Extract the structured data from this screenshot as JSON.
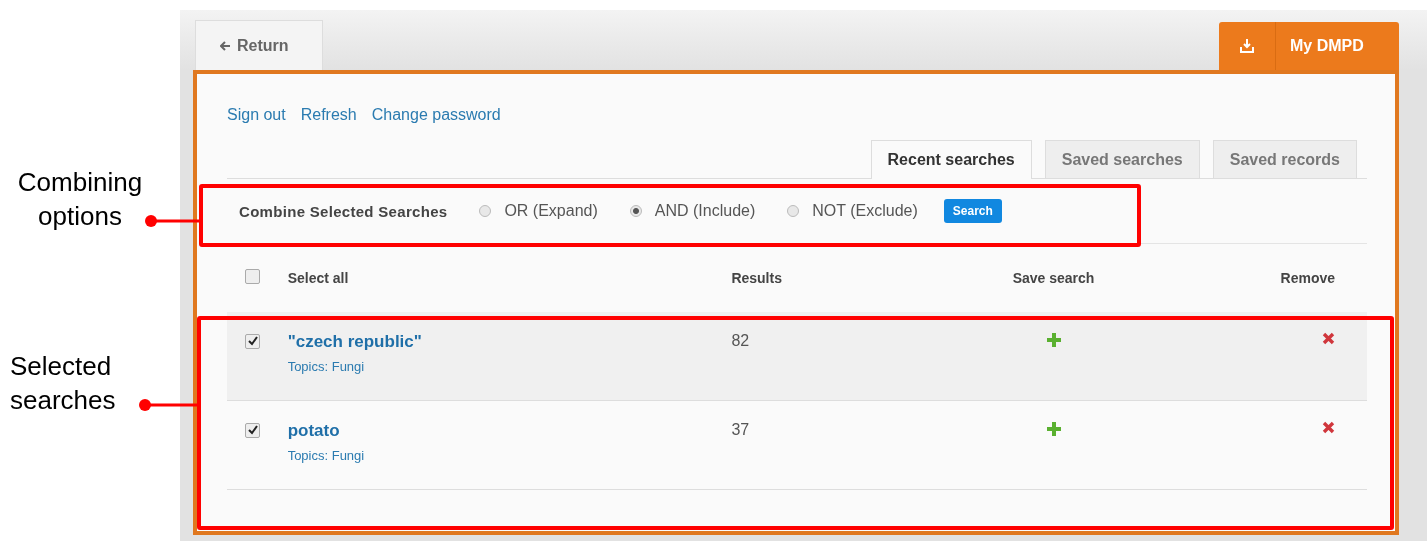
{
  "back_tab": {
    "label": "Return"
  },
  "account_tab": {
    "label": "My DMPD"
  },
  "links": [
    "Sign out",
    "Refresh",
    "Change password"
  ],
  "tabs": [
    {
      "label": "Recent searches",
      "selected": true
    },
    {
      "label": "Saved searches",
      "selected": false
    },
    {
      "label": "Saved records",
      "selected": false
    }
  ],
  "combine": {
    "label": "Combine Selected Searches",
    "options": [
      {
        "label": "OR (Expand)",
        "selected": false
      },
      {
        "label": "AND (Include)",
        "selected": true
      },
      {
        "label": "NOT (Exclude)",
        "selected": false
      }
    ],
    "button": "Search"
  },
  "table": {
    "select_all": {
      "label": "Select all",
      "checked": false
    },
    "columns": [
      "Results",
      "Save search",
      "Remove"
    ],
    "rows": [
      {
        "query": "\"czech republic\"",
        "topics": "Topics: Fungi",
        "results": "82",
        "checked": true
      },
      {
        "query": "potato",
        "topics": "Topics: Fungi",
        "results": "37",
        "checked": true
      }
    ]
  },
  "callouts": [
    {
      "label": "Combining options"
    },
    {
      "label": "Selected searches"
    }
  ]
}
